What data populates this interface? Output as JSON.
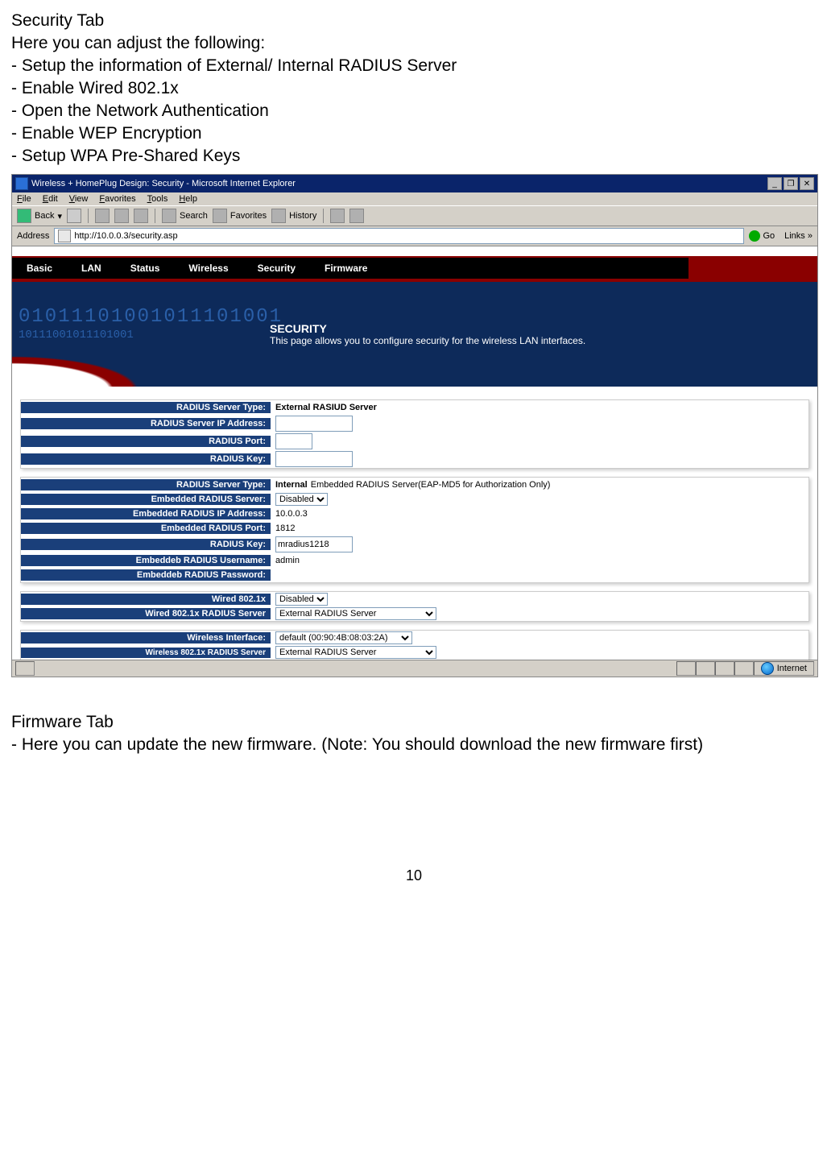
{
  "doc": {
    "heading": "Security Tab",
    "intro": "Here you can adjust the following:",
    "bullets": [
      "- Setup the information of External/ Internal RADIUS Server",
      "- Enable Wired 802.1x",
      "- Open the Network Authentication",
      "- Enable WEP Encryption",
      "- Setup WPA Pre-Shared Keys"
    ],
    "section2_heading": "Firmware Tab",
    "section2_text": "- Here you can update the new firmware. (Note: You should download the new firmware first)",
    "page_number": "10"
  },
  "browser": {
    "title": "Wireless + HomePlug Design: Security - Microsoft Internet Explorer",
    "menus": [
      "File",
      "Edit",
      "View",
      "Favorites",
      "Tools",
      "Help"
    ],
    "toolbar": {
      "back": "Back",
      "search": "Search",
      "favorites": "Favorites",
      "history": "History"
    },
    "address_label": "Address",
    "address_value": "http://10.0.0.3/security.asp",
    "go_label": "Go",
    "links_label": "Links",
    "status_zone": "Internet"
  },
  "page": {
    "tabs": [
      "Basic",
      "LAN",
      "Status",
      "Wireless",
      "Security",
      "Firmware"
    ],
    "hero_digits_top": "01011101001011101001",
    "hero_digits_mid": "10111001011101001",
    "hero_title": "SECURITY",
    "hero_sub": "This page allows you to configure security for the wireless LAN interfaces.",
    "block1": {
      "r1_label": "RADIUS Server Type:",
      "r1_value": "External RASIUD Server",
      "r2_label": "RADIUS Server IP Address:",
      "r3_label": "RADIUS Port:",
      "r4_label": "RADIUS Key:"
    },
    "block2": {
      "r1_label": "RADIUS Server Type:",
      "r1_value_strong": "Internal",
      "r1_value_rest": " Embedded RADIUS Server(EAP-MD5 for Authorization Only)",
      "r2_label": "Embedded RADIUS Server:",
      "r2_select": "Disabled",
      "r3_label": "Embedded RADIUS IP Address:",
      "r3_value": "10.0.0.3",
      "r4_label": "Embedded RADIUS Port:",
      "r4_value": "1812",
      "r5_label": "RADIUS Key:",
      "r5_value": "mradius1218",
      "r6_label": "Embeddeb RADIUS Username:",
      "r6_value": "admin",
      "r7_label": "Embeddeb RADIUS Password:"
    },
    "block3": {
      "r1_label": "Wired 802.1x",
      "r1_select": "Disabled",
      "r2_label": "Wired 802.1x RADIUS Server",
      "r2_select": "External RADIUS Server"
    },
    "block4": {
      "r1_label": "Wireless Interface:",
      "r1_select": "default (00:90:4B:08:03:2A)",
      "r2_label": "Wireless 802.1x RADIUS Server",
      "r2_select": "External RADIUS Server"
    }
  }
}
